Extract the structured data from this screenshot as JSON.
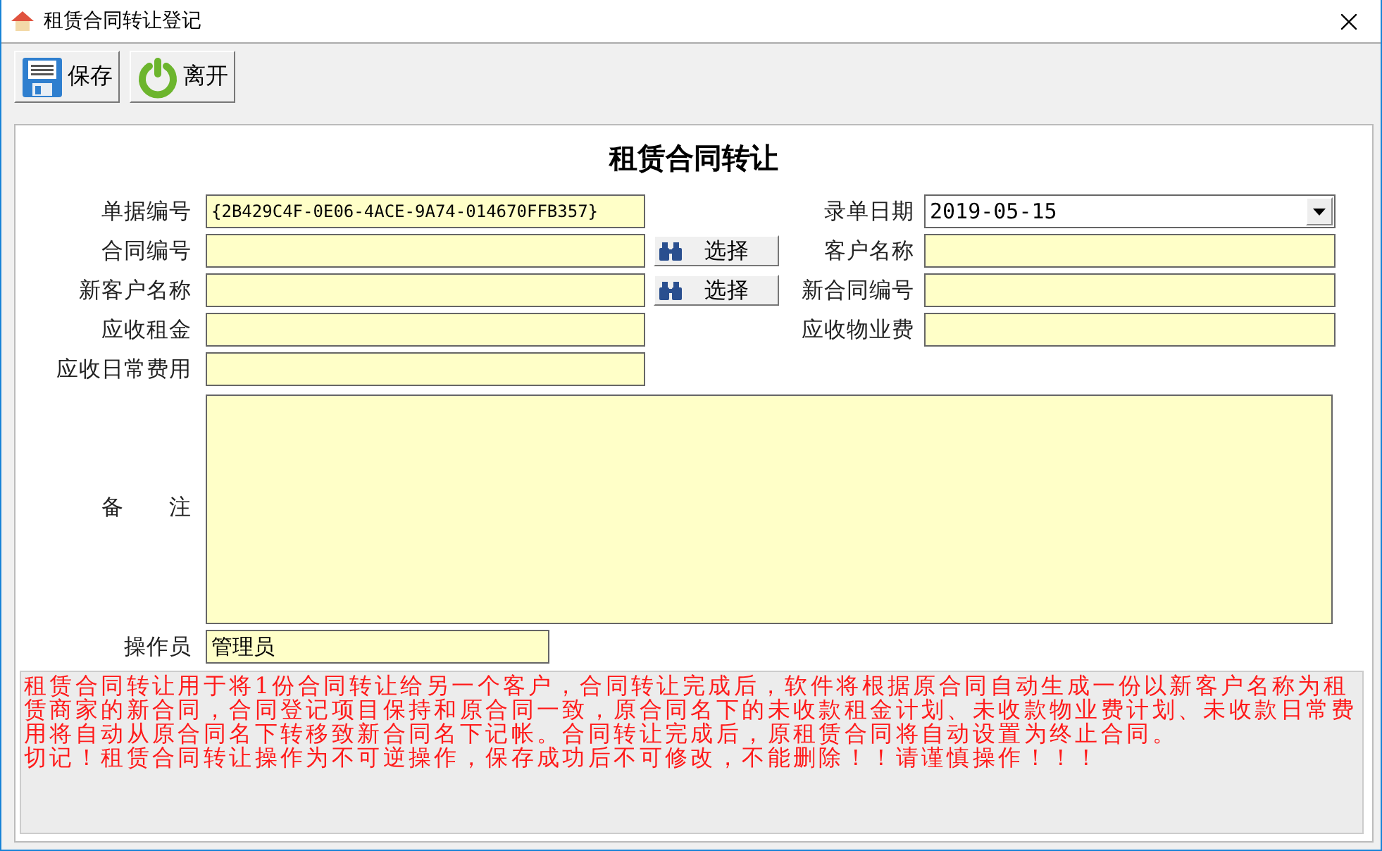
{
  "window": {
    "title": "租赁合同转让登记"
  },
  "toolbar": [
    {
      "label": "保存",
      "kind": "save"
    },
    {
      "label": "离开",
      "kind": "exit"
    }
  ],
  "form": {
    "title": "租赁合同转让",
    "rows": [
      {
        "left": {
          "label": "单据编号",
          "value": "{2B429C4F-0E06-4ACE-9A74-014670FFB357}"
        },
        "right": {
          "label": "录单日期",
          "value": "2019-05-15",
          "kind": "dropdown"
        }
      },
      {
        "left": {
          "label": "合同编号",
          "button": "选择"
        },
        "right": {
          "label": "客户名称",
          "kind": "text"
        }
      },
      {
        "left": {
          "label": "新客户名称",
          "button": "选择"
        },
        "right": {
          "label": "新合同编号",
          "kind": "text"
        }
      },
      {
        "left": {
          "label": "应收租金"
        },
        "right": {
          "label": "应收物业费",
          "kind": "text"
        }
      },
      {
        "left": {
          "label": "应收日常费用"
        }
      }
    ],
    "memo": {
      "label": "备　　注"
    },
    "operator": {
      "label": "操作员",
      "value": "管理员"
    },
    "notice": [
      "租赁合同转让用于将1份合同转让给另一个客户，合同转让完成后，软件将根据原合同自动生成一份以新客户名称为租赁商家的新合同，合同登记项目保持和原合同一致，原合同名下的未收款租金计划、未收款物业费计划、未收款日常费用将自动从原合同名下转移致新合同名下记帐。合同转让完成后，原租赁合同将自动设置为终止合同。",
      "切记！租赁合同转让操作为不可逆操作，保存成功后不可修改，不能删除！！请谨慎操作！！！"
    ]
  }
}
